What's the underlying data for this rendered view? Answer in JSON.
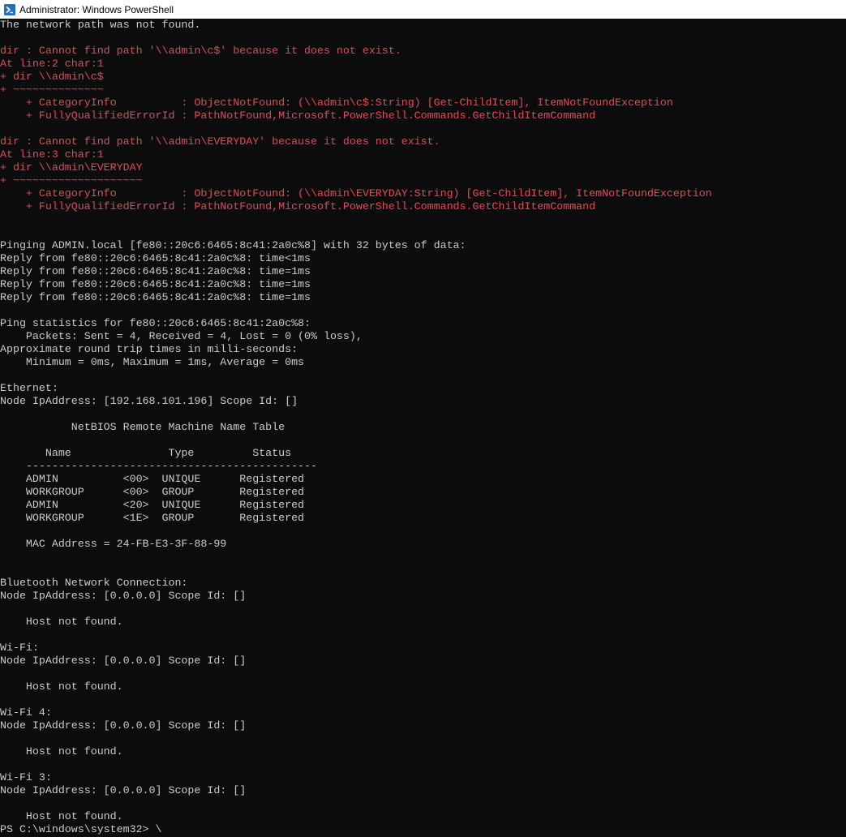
{
  "window": {
    "title": "Administrator: Windows PowerShell",
    "icon": "powershell-icon"
  },
  "colors": {
    "background": "#0c0c0c",
    "foreground": "#cccccc",
    "error": "#e74856",
    "titlebar": "#ffffff"
  },
  "console": {
    "lines": [
      {
        "text": "The network path was not found.",
        "style": "normal"
      },
      {
        "text": "",
        "style": "normal"
      },
      {
        "text": "dir : Cannot find path '\\\\admin\\c$' because it does not exist.",
        "style": "error"
      },
      {
        "text": "At line:2 char:1",
        "style": "error"
      },
      {
        "text": "+ dir \\\\admin\\c$",
        "style": "error"
      },
      {
        "text": "+ ~~~~~~~~~~~~~~",
        "style": "error"
      },
      {
        "text": "    + CategoryInfo          : ObjectNotFound: (\\\\admin\\c$:String) [Get-ChildItem], ItemNotFoundException",
        "style": "error"
      },
      {
        "text": "    + FullyQualifiedErrorId : PathNotFound,Microsoft.PowerShell.Commands.GetChildItemCommand",
        "style": "error"
      },
      {
        "text": "",
        "style": "normal"
      },
      {
        "text": "dir : Cannot find path '\\\\admin\\EVERYDAY' because it does not exist.",
        "style": "error"
      },
      {
        "text": "At line:3 char:1",
        "style": "error"
      },
      {
        "text": "+ dir \\\\admin\\EVERYDAY",
        "style": "error"
      },
      {
        "text": "+ ~~~~~~~~~~~~~~~~~~~~",
        "style": "error"
      },
      {
        "text": "    + CategoryInfo          : ObjectNotFound: (\\\\admin\\EVERYDAY:String) [Get-ChildItem], ItemNotFoundException",
        "style": "error"
      },
      {
        "text": "    + FullyQualifiedErrorId : PathNotFound,Microsoft.PowerShell.Commands.GetChildItemCommand",
        "style": "error"
      },
      {
        "text": "",
        "style": "normal"
      },
      {
        "text": "",
        "style": "normal"
      },
      {
        "text": "Pinging ADMIN.local [fe80::20c6:6465:8c41:2a0c%8] with 32 bytes of data:",
        "style": "normal"
      },
      {
        "text": "Reply from fe80::20c6:6465:8c41:2a0c%8: time<1ms",
        "style": "normal"
      },
      {
        "text": "Reply from fe80::20c6:6465:8c41:2a0c%8: time=1ms",
        "style": "normal"
      },
      {
        "text": "Reply from fe80::20c6:6465:8c41:2a0c%8: time=1ms",
        "style": "normal"
      },
      {
        "text": "Reply from fe80::20c6:6465:8c41:2a0c%8: time=1ms",
        "style": "normal"
      },
      {
        "text": "",
        "style": "normal"
      },
      {
        "text": "Ping statistics for fe80::20c6:6465:8c41:2a0c%8:",
        "style": "normal"
      },
      {
        "text": "    Packets: Sent = 4, Received = 4, Lost = 0 (0% loss),",
        "style": "normal"
      },
      {
        "text": "Approximate round trip times in milli-seconds:",
        "style": "normal"
      },
      {
        "text": "    Minimum = 0ms, Maximum = 1ms, Average = 0ms",
        "style": "normal"
      },
      {
        "text": "",
        "style": "normal"
      },
      {
        "text": "Ethernet:",
        "style": "normal"
      },
      {
        "text": "Node IpAddress: [192.168.101.196] Scope Id: []",
        "style": "normal"
      },
      {
        "text": "",
        "style": "normal"
      },
      {
        "text": "           NetBIOS Remote Machine Name Table",
        "style": "normal"
      },
      {
        "text": "",
        "style": "normal"
      },
      {
        "text": "       Name               Type         Status",
        "style": "normal"
      },
      {
        "text": "    ---------------------------------------------",
        "style": "normal"
      },
      {
        "text": "    ADMIN          <00>  UNIQUE      Registered",
        "style": "normal"
      },
      {
        "text": "    WORKGROUP      <00>  GROUP       Registered",
        "style": "normal"
      },
      {
        "text": "    ADMIN          <20>  UNIQUE      Registered",
        "style": "normal"
      },
      {
        "text": "    WORKGROUP      <1E>  GROUP       Registered",
        "style": "normal"
      },
      {
        "text": "",
        "style": "normal"
      },
      {
        "text": "    MAC Address = 24-FB-E3-3F-88-99",
        "style": "normal"
      },
      {
        "text": "",
        "style": "normal"
      },
      {
        "text": "",
        "style": "normal"
      },
      {
        "text": "Bluetooth Network Connection:",
        "style": "normal"
      },
      {
        "text": "Node IpAddress: [0.0.0.0] Scope Id: []",
        "style": "normal"
      },
      {
        "text": "",
        "style": "normal"
      },
      {
        "text": "    Host not found.",
        "style": "normal"
      },
      {
        "text": "",
        "style": "normal"
      },
      {
        "text": "Wi-Fi:",
        "style": "normal"
      },
      {
        "text": "Node IpAddress: [0.0.0.0] Scope Id: []",
        "style": "normal"
      },
      {
        "text": "",
        "style": "normal"
      },
      {
        "text": "    Host not found.",
        "style": "normal"
      },
      {
        "text": "",
        "style": "normal"
      },
      {
        "text": "Wi-Fi 4:",
        "style": "normal"
      },
      {
        "text": "Node IpAddress: [0.0.0.0] Scope Id: []",
        "style": "normal"
      },
      {
        "text": "",
        "style": "normal"
      },
      {
        "text": "    Host not found.",
        "style": "normal"
      },
      {
        "text": "",
        "style": "normal"
      },
      {
        "text": "Wi-Fi 3:",
        "style": "normal"
      },
      {
        "text": "Node IpAddress: [0.0.0.0] Scope Id: []",
        "style": "normal"
      },
      {
        "text": "",
        "style": "normal"
      },
      {
        "text": "    Host not found.",
        "style": "normal"
      },
      {
        "text": "PS C:\\windows\\system32> \\",
        "style": "normal"
      }
    ]
  }
}
